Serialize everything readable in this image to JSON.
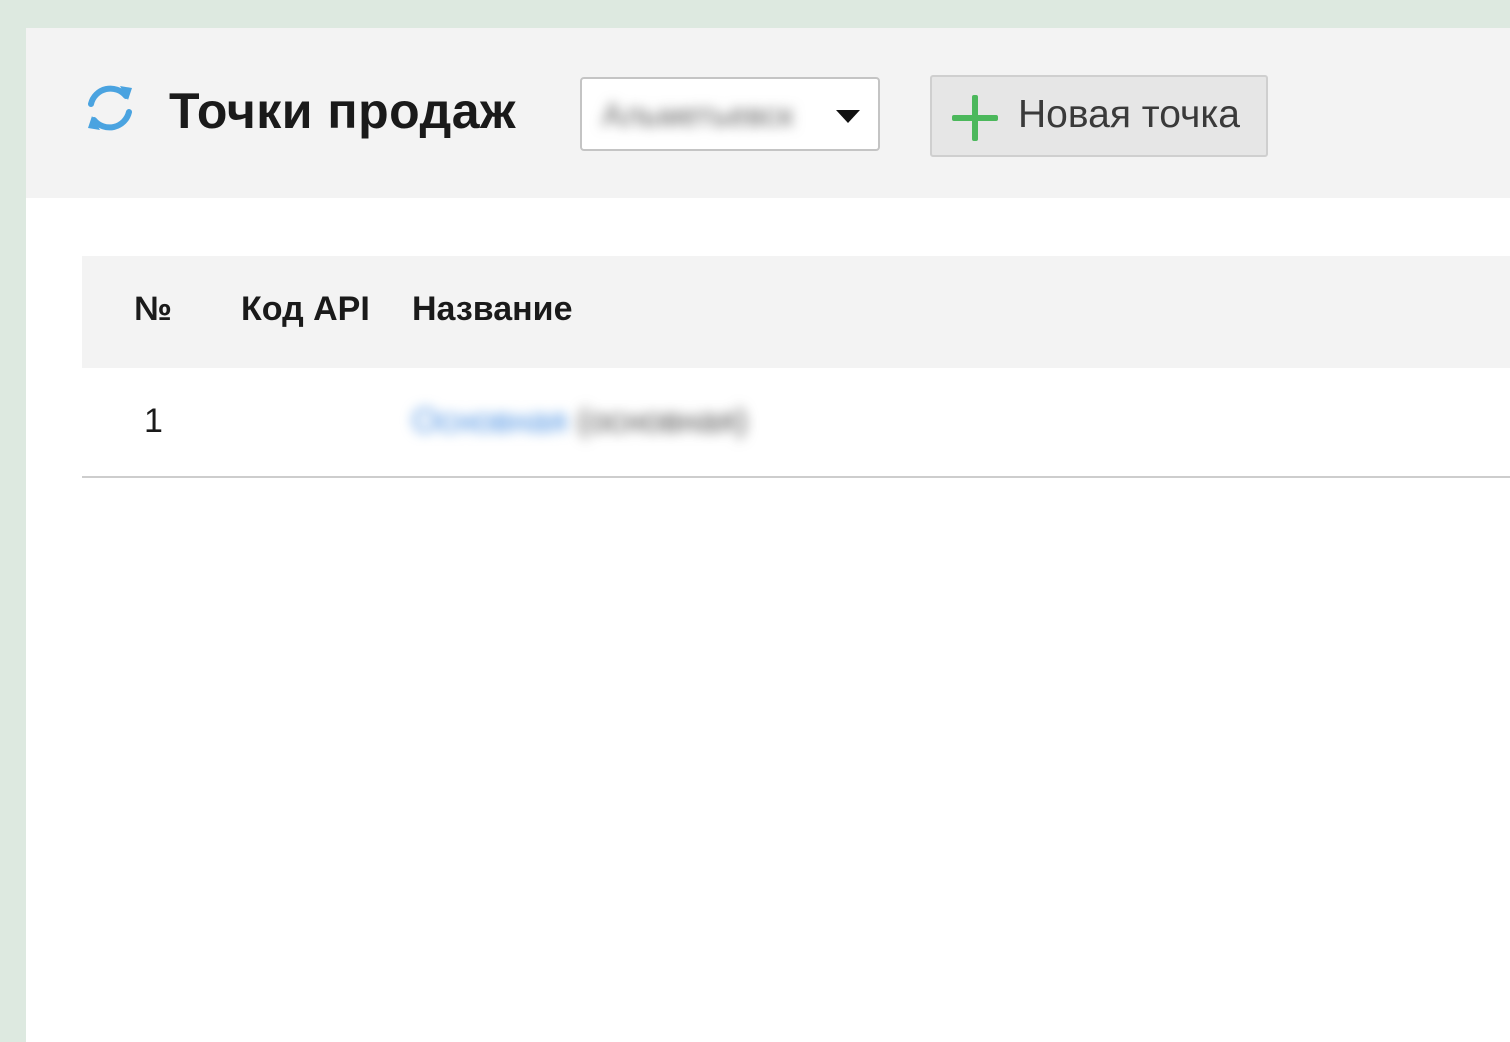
{
  "header": {
    "title": "Точки продаж",
    "company_select": {
      "value": "Альметьевск"
    },
    "new_button_label": "Новая точка"
  },
  "colors": {
    "refresh_icon": "#4aa3e0",
    "plus_icon": "#4cb85c",
    "link": "#4a90e2"
  },
  "table": {
    "columns": [
      "№",
      "Код API",
      "Название"
    ],
    "rows": [
      {
        "num": "1",
        "api_code": "",
        "name": "Основная",
        "name_suffix": "(основная)"
      }
    ]
  }
}
